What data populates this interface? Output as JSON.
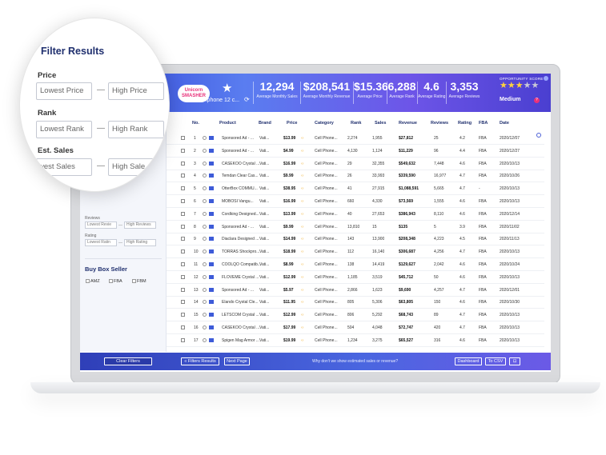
{
  "magnifier": {
    "title": "Filter Results",
    "price_label": "Price",
    "price_min_placeholder": "Lowest Price",
    "price_max_placeholder": "High Price",
    "rank_label": "Rank",
    "rank_min_placeholder": "Lowest Rank",
    "rank_max_placeholder": "High Rank",
    "sales_label": "Est. Sales",
    "sales_min_placeholder": "west Sales",
    "sales_max_placeholder": "High Sale",
    "dash": "—"
  },
  "header": {
    "logo_line1": "Unicorn",
    "logo_line2": "SMASHER",
    "search_term": "iphone 12 c...",
    "stats": [
      {
        "value": "12,294",
        "label": "Average Monthly Sales"
      },
      {
        "value": "$208,541",
        "label": "Average Monthly Revenue"
      },
      {
        "value": "$15.36",
        "label": "Average Price"
      },
      {
        "value": "6,288",
        "label": "Average Rank"
      },
      {
        "value": "4.6",
        "label": "Average Rating"
      },
      {
        "value": "3,353",
        "label": "Average Reviews"
      }
    ],
    "opportunity_label": "OPPORTUNITY SCORE",
    "opportunity_level": "Medium",
    "opportunity_stars_on": 3,
    "opportunity_stars_total": 5,
    "help": "?"
  },
  "sidebar": {
    "reviews_label": "Reviews",
    "reviews_min": "Lowest Revie",
    "reviews_max": "High Reviews",
    "rating_label": "Rating",
    "rating_min": "Lowest Ratin",
    "rating_max": "High Rating",
    "dash": "—",
    "buy_box_title": "Buy Box Seller",
    "checks": [
      "AMZ",
      "FBA",
      "FBM"
    ]
  },
  "table": {
    "headers": [
      "No.",
      "Product",
      "Brand",
      "Price",
      "Category",
      "Rank",
      "Sales",
      "Revenue",
      "Reviews",
      "Rating",
      "FBA",
      "Date"
    ],
    "rows": [
      {
        "no": "1",
        "product": "Sponsored Ad - ...",
        "brand": "Vati...",
        "price": "$13.99",
        "category": "Cell Phone...",
        "rank": "2,274",
        "sales": "1,955",
        "revenue": "$27,812",
        "reviews": "25",
        "rating": "4.2",
        "fba": "FBA",
        "date": "2020/12/07"
      },
      {
        "no": "2",
        "product": "Sponsored Ad - ...",
        "brand": "Vati...",
        "price": "$4.99",
        "category": "Cell Phone...",
        "rank": "4,130",
        "sales": "1,124",
        "revenue": "$11,229",
        "reviews": "96",
        "rating": "4.4",
        "fba": "FBA",
        "date": "2020/12/27"
      },
      {
        "no": "3",
        "product": "CASEKOO Crystal ...",
        "brand": "Vati...",
        "price": "$16.99",
        "category": "Cell Phone...",
        "rank": "29",
        "sales": "32,355",
        "revenue": "$549,632",
        "reviews": "7,448",
        "rating": "4.6",
        "fba": "FBA",
        "date": "2020/10/13"
      },
      {
        "no": "4",
        "product": "Temdan Clear Cas...",
        "brand": "Vati...",
        "price": "$9.99",
        "category": "Cell Phone...",
        "rank": "26",
        "sales": "33,993",
        "revenue": "$339,590",
        "reviews": "16,977",
        "rating": "4.7",
        "fba": "FBA",
        "date": "2020/10/26"
      },
      {
        "no": "5",
        "product": "OtterBox COMMU...",
        "brand": "Vati...",
        "price": "$38.95",
        "category": "Cell Phone...",
        "rank": "41",
        "sales": "27,915",
        "revenue": "$1,088,591",
        "reviews": "5,665",
        "rating": "4.7",
        "fba": "-",
        "date": "2020/10/13"
      },
      {
        "no": "6",
        "product": "MOBOSI Vangu...",
        "brand": "Vati...",
        "price": "$16.99",
        "category": "Cell Phone...",
        "rank": "660",
        "sales": "4,330",
        "revenue": "$73,569",
        "reviews": "1,555",
        "rating": "4.6",
        "fba": "FBA",
        "date": "2020/10/13"
      },
      {
        "no": "7",
        "product": "Cordking Designed...",
        "brand": "Vati...",
        "price": "$13.99",
        "category": "Cell Phone...",
        "rank": "40",
        "sales": "27,653",
        "revenue": "$386,943",
        "reviews": "8,110",
        "rating": "4.6",
        "fba": "FBA",
        "date": "2020/12/14"
      },
      {
        "no": "8",
        "product": "Sponsored Ad - ...",
        "brand": "Vati...",
        "price": "$9.99",
        "category": "Cell Phone...",
        "rank": "13,810",
        "sales": "15",
        "revenue": "$135",
        "reviews": "5",
        "rating": "3.9",
        "fba": "FBA",
        "date": "2020/11/02"
      },
      {
        "no": "9",
        "product": "Diaclara Designed ...",
        "brand": "Vati...",
        "price": "$14.99",
        "category": "Cell Phone...",
        "rank": "143",
        "sales": "13,900",
        "revenue": "$208,348",
        "reviews": "4,223",
        "rating": "4.5",
        "fba": "FBA",
        "date": "2020/11/13"
      },
      {
        "no": "10",
        "product": "TORRAS Shockpro...",
        "brand": "Vati...",
        "price": "$18.99",
        "category": "Cell Phone...",
        "rank": "112",
        "sales": "16,140",
        "revenue": "$306,687",
        "reviews": "4,256",
        "rating": "4.7",
        "fba": "FBA",
        "date": "2020/10/13"
      },
      {
        "no": "11",
        "product": "COOLQO Compatib...",
        "brand": "Vati...",
        "price": "$8.99",
        "category": "Cell Phone...",
        "rank": "138",
        "sales": "14,419",
        "revenue": "$129,627",
        "reviews": "2,042",
        "rating": "4.6",
        "fba": "FBA",
        "date": "2020/10/24"
      },
      {
        "no": "12",
        "product": "FLOVEME Crystal ...",
        "brand": "Vati...",
        "price": "$12.99",
        "category": "Cell Phone...",
        "rank": "1,185",
        "sales": "3,519",
        "revenue": "$45,712",
        "reviews": "50",
        "rating": "4.6",
        "fba": "FBA",
        "date": "2020/10/13"
      },
      {
        "no": "13",
        "product": "Sponsored Ad - ...",
        "brand": "Vati...",
        "price": "$5.97",
        "category": "Cell Phone...",
        "rank": "2,866",
        "sales": "1,623",
        "revenue": "$9,690",
        "reviews": "4,257",
        "rating": "4.7",
        "fba": "FBA",
        "date": "2020/12/01"
      },
      {
        "no": "14",
        "product": "Elando Crystal Cle...",
        "brand": "Vati...",
        "price": "$11.95",
        "category": "Cell Phone...",
        "rank": "805",
        "sales": "5,306",
        "revenue": "$63,805",
        "reviews": "150",
        "rating": "4.6",
        "fba": "FBA",
        "date": "2020/10/30"
      },
      {
        "no": "15",
        "product": "LETSCOM Crystal ...",
        "brand": "Vati...",
        "price": "$12.99",
        "category": "Cell Phone...",
        "rank": "806",
        "sales": "5,292",
        "revenue": "$68,743",
        "reviews": "89",
        "rating": "4.7",
        "fba": "FBA",
        "date": "2020/10/13"
      },
      {
        "no": "16",
        "product": "CASEKOO Crystal ...",
        "brand": "Vati...",
        "price": "$17.99",
        "category": "Cell Phone...",
        "rank": "504",
        "sales": "4,048",
        "revenue": "$72,747",
        "reviews": "420",
        "rating": "4.7",
        "fba": "FBA",
        "date": "2020/10/13"
      },
      {
        "no": "17",
        "product": "Spigen Mag Armor ...",
        "brand": "Vati...",
        "price": "$19.99",
        "category": "Cell Phone...",
        "rank": "1,234",
        "sales": "3,275",
        "revenue": "$65,527",
        "reviews": "316",
        "rating": "4.6",
        "fba": "FBA",
        "date": "2020/10/13"
      }
    ]
  },
  "footer": {
    "clear_filters": "Clear Filters",
    "filters_results": "« Filters Results",
    "next_page": "Next Page",
    "note": "Why don't we show estimated sales or revenue?",
    "dashboard": "Dashboard",
    "to_csv": "To CSV"
  },
  "colors": {
    "header_start": "#3145d6",
    "header_end": "#4a3fd0",
    "title_navy": "#1f2f6e",
    "logo_pink": "#e8317a",
    "star_yellow": "#ffd23d"
  }
}
